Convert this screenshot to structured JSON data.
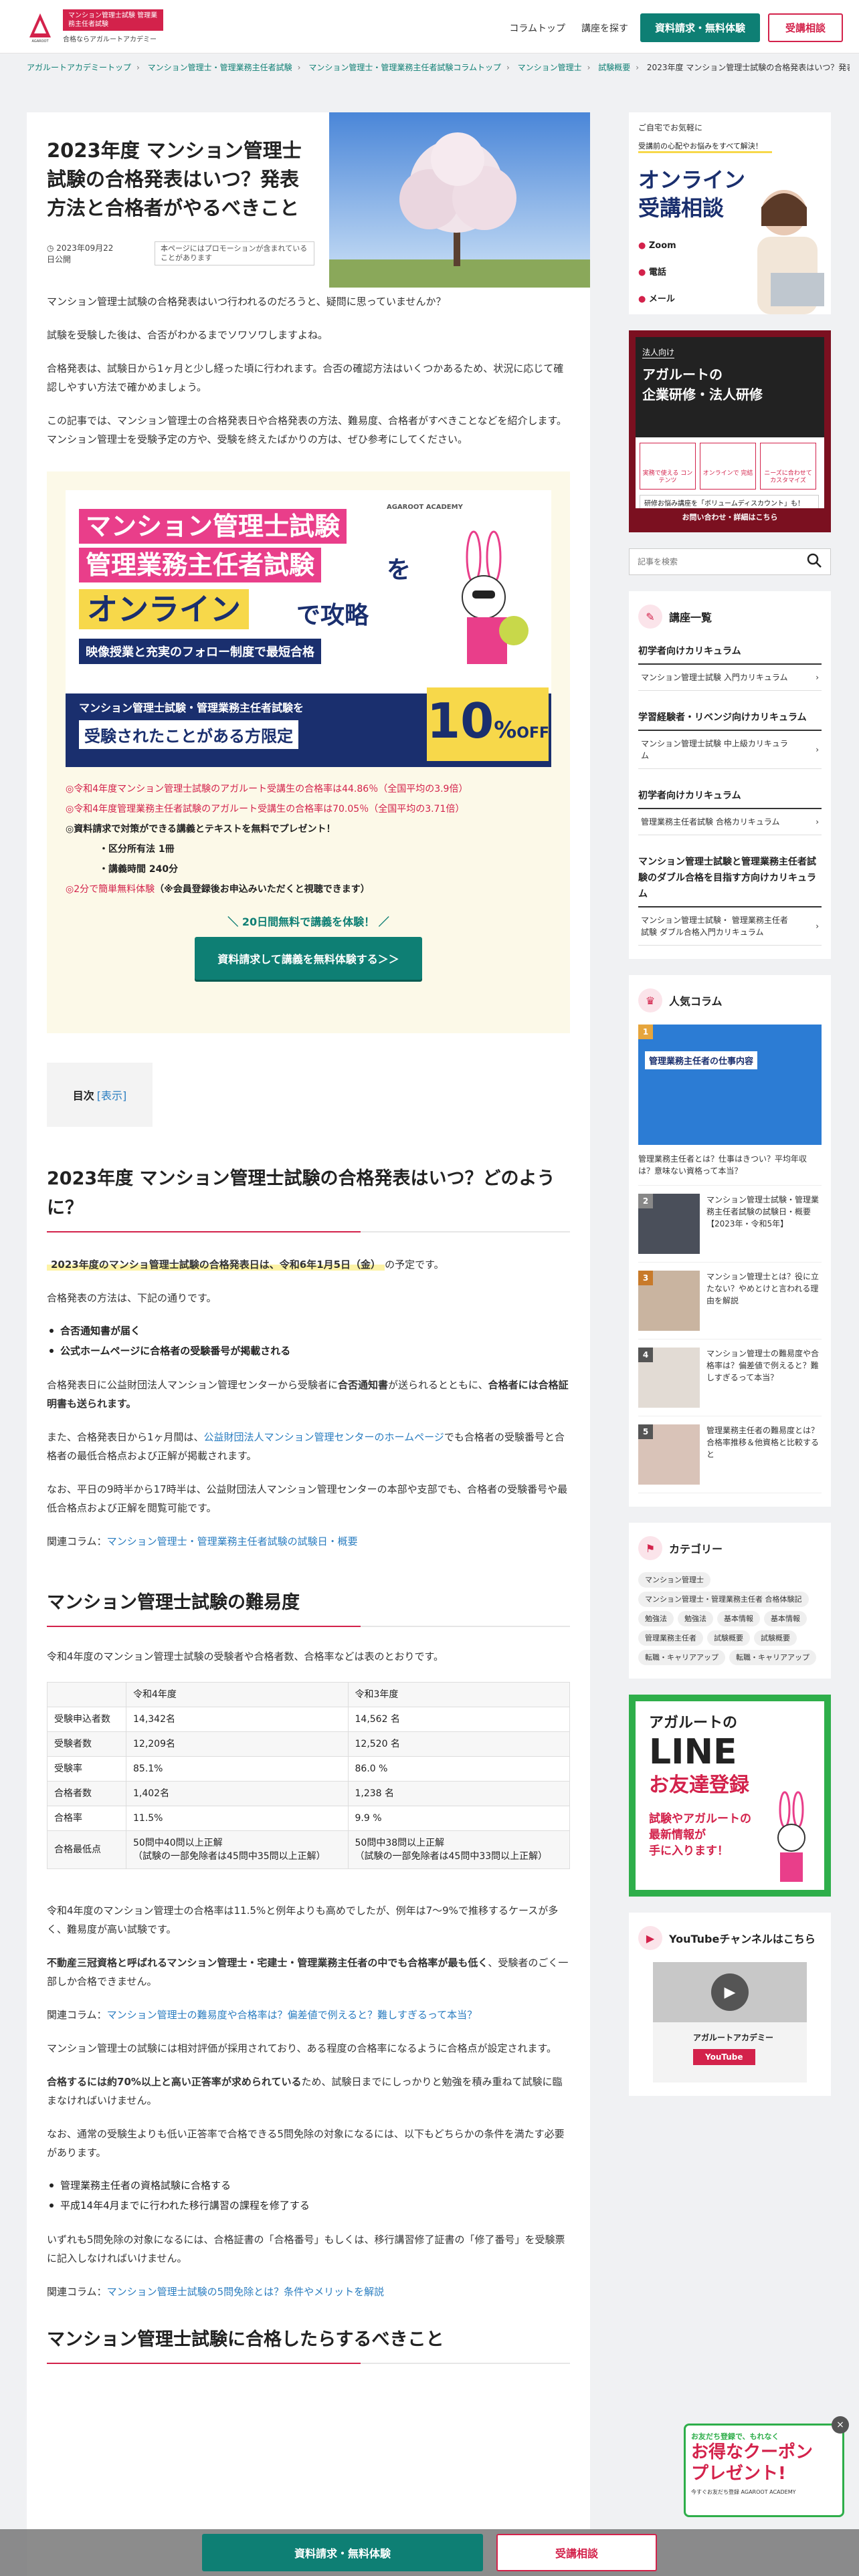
{
  "header": {
    "logo_tag": "マンション管理士試験 管理業務主任者試験",
    "logo_tag2": "合格ならアガルートアカデミー",
    "logo_brand": "AGAROOT ACADEMY",
    "nav": [
      "コラムトップ",
      "講座を探す"
    ],
    "cta_primary": "資料請求・無料体験",
    "cta_secondary": "受講相談"
  },
  "breadcrumb": [
    "アガルートアカデミートップ",
    "マンション管理士・管理業務主任者試験",
    "マンション管理士・管理業務主任者試験コラムトップ",
    "マンション管理士",
    "試験概要",
    "2023年度 マンション管理士試験の合格発表はいつ？発表方法と合格者がやるべきこと"
  ],
  "article": {
    "title": "2023年度 マンション管理士試験の合格発表はいつ？発表方法と合格者がやるべきこと",
    "date": "2023年09月22日公開",
    "promo_note": "本ページにはプロモーションが含まれていることがあります",
    "intro": [
      "マンション管理士試験の合格発表はいつ行われるのだろうと、疑問に思っていませんか？",
      "試験を受験した後は、合否がわかるまでソワソワしますよね。",
      "合格発表は、試験日から1ヶ月と少し経った頃に行われます。合否の確認方法はいくつかあるため、状況に応じて確認しやすい方法で確かめましょう。",
      "この記事では、マンション管理士の合格発表日や合格発表の方法、難易度、合格者がすべきことなどを紹介します。マンション管理士を受験予定の方や、受験を終えたばかりの方は、ぜひ参考にしてください。"
    ],
    "banner": {
      "line1": "マンション管理士試験",
      "line2": "管理業務主任者試験",
      "line2b": "を",
      "line3": "オンライン",
      "line3b": "で攻略",
      "line4": "映像授業と充実のフォロー制度で最短合格",
      "offer1": "マンション管理士試験・管理業務主任者試験を",
      "offer2": "受験されたことがある方限定",
      "discount": "10",
      "discount_unit": "%",
      "off": "OFF",
      "brand": "AGAROOT ACADEMY",
      "points": [
        "◎令和4年度マンション管理士試験のアガルート受講生の合格率は44.86％（全国平均の3.9倍）",
        "◎令和4年度管理業務主任者試験のアガルート受講生の合格率は70.05％（全国平均の3.71倍）"
      ],
      "gift_title": "◎資料請求で対策ができる講義とテキストを無料でプレゼント！",
      "gift_items": [
        "・区分所有法 1冊",
        "・講義時間 240分"
      ],
      "signup": "◎2分で簡単無料体験",
      "signup_note": "（※会員登録後お申込みいただくと視聴できます）",
      "cta_label": "＼ 20日間無料で講義を体験！ ／",
      "cta_button": "資料請求して講義を無料体験する＞＞"
    },
    "toc": {
      "label": "目次",
      "toggle": "[表示]"
    },
    "sec1": {
      "heading": "2023年度 マンション管理士試験の合格発表はいつ？どのように？",
      "lead": "2023年度のマンショ管理士試験の合格発表日は、令和6年1月5日（金）",
      "lead_tail": "の予定です。",
      "method_intro": "合格発表の方法は、下記の通りです。",
      "methods": [
        "合否通知書が届く",
        "公式ホームページに合格者の受験番号が掲載される"
      ],
      "p1a": "合格発表日に公益財団法人マンション管理センターから受験者に",
      "p1b": "合否通知書",
      "p1c": "が送られるとともに、",
      "p1d": "合格者には合格証明書も送られます。",
      "p2a": "また、合格発表日から1ヶ月間は、",
      "p2link": "公益財団法人マンション管理センターのホームページ",
      "p2b": "でも合格者の受験番号と合格者の最低合格点および正解が掲載されます。",
      "p3": "なお、平日の9時半から17時半は、公益財団法人マンション管理センターの本部や支部でも、合格者の受験番号や最低合格点および正解を閲覧可能です。",
      "related_label": "関連コラム：",
      "related_link": "マンション管理士・管理業務主任者試験の試験日・概要"
    },
    "sec2": {
      "heading": "マンション管理士試験の難易度",
      "intro": "令和4年度のマンション管理士試験の受験者や合格者数、合格率などは表のとおりです。",
      "table_head": [
        "",
        "令和4年度",
        "令和3年度"
      ],
      "table_rows": [
        [
          "受験申込者数",
          "14,342名",
          "14,562 名"
        ],
        [
          "受験者数",
          "12,209名",
          "12,520 名"
        ],
        [
          "受験率",
          "85.1%",
          "86.0 %"
        ],
        [
          "合格者数",
          "1,402名",
          "1,238 名"
        ],
        [
          "合格率",
          "11.5%",
          "9.9 %"
        ]
      ],
      "table_last_label": "合格最低点",
      "table_last_a1": "50問中40問以上正解",
      "table_last_a2": "（試験の一部免除者は45問中35問以上正解）",
      "table_last_b1": "50問中38問以上正解",
      "table_last_b2": "（試験の一部免除者は45問中33問以上正解）",
      "p1": "令和4年度のマンション管理士の合格率は11.5%と例年よりも高めでしたが、例年は7〜9%で推移するケースが多く、難易度が高い試験です。",
      "p2a": "不動産三冠資格と呼ばれるマンション管理士・宅建士・管理業務主任者の中でも合格率が最も低く",
      "p2b": "、受験者のごく一部しか合格できません。",
      "related1": "マンション管理士の難易度や合格率は？偏差値で例えると？難しすぎるって本当？",
      "p3": "マンション管理士の試験には相対評価が採用されており、ある程度の合格率になるように合格点が設定されます。",
      "p4a": "合格するには約70%以上と高い正答率が求められている",
      "p4b": "ため、試験日までにしっかりと勉強を積み重ねて試験に臨まなければいけません。",
      "p5": "なお、通常の受験生よりも低い正答率で合格できる5問免除の対象になるには、以下もどちらかの条件を満たす必要があります。",
      "conds": [
        "管理業務主任者の資格試験に合格する",
        "平成14年4月までに行われた移行講習の課程を修了する"
      ],
      "p6": "いずれも5問免除の対象になるには、合格証書の「合格番号」もしくは、移行講習修了証書の「修了番号」を受験票に記入しなければいけません。",
      "related2": "マンション管理士試験の5問免除とは？条件やメリットを解説",
      "next_heading": "マンション管理士試験に合格したらするべきこと"
    }
  },
  "sidebar": {
    "online": {
      "tag1": "ご自宅でお気軽に",
      "tag2": "受講前の心配やお悩みをすべて解決！",
      "title1": "オンライン",
      "title2": "受講相談",
      "methods": [
        "Zoom",
        "電話",
        "メール"
      ]
    },
    "corp": {
      "tag": "法人向け",
      "title1": "アガルートの",
      "title2": "企業研修・法人研修",
      "feat": [
        "実務で使える コンテンツ",
        "オンラインで 完結",
        "ニーズに合わせて カスタマイズ"
      ],
      "note": "研修お悩み講座を「ボリュームディスカウント」も！",
      "cta": "お問い合わせ・詳細はこちら"
    },
    "search_placeholder": "記事を検索",
    "courses": {
      "title": "講座一覧",
      "sections": [
        {
          "head": "初学者向けカリキュラム",
          "items": [
            "マンション管理士試験 入門カリキュラム"
          ]
        },
        {
          "head": "学習経験者・リベンジ向けカリキュラム",
          "items": [
            "マンション管理士試験 中上級カリキュラム"
          ]
        },
        {
          "head": "初学者向けカリキュラム",
          "items": [
            "管理業務主任者試験 合格カリキュラム"
          ]
        },
        {
          "head": "マンション管理士試験と管理業務主任者試験のダブル合格を目指す方向けカリキュラム",
          "items": [
            "マンション管理士試験・ 管理業務主任者試験 ダブル合格入門カリキュラム"
          ]
        }
      ]
    },
    "popular": {
      "title": "人気コラム",
      "first": "管理業務主任者とは？仕事はきつい？平均年収は？意味ない資格って本当？",
      "first_img_text": "管理業務主任者の仕事内容",
      "items": [
        {
          "num": "2",
          "title": "マンション管理士試験・管理業務主任者試験の試験日・概要【2023年・令和5年】"
        },
        {
          "num": "3",
          "title": "マンション管理士とは？役に立たない？やめとけと言われる理由を解説"
        },
        {
          "num": "4",
          "title": "マンション管理士の難易度や合格率は？偏差値で例えると？難しすぎるって本当？"
        },
        {
          "num": "5",
          "title": "管理業務主任者の難易度とは？合格率推移＆他資格と比較すると"
        }
      ]
    },
    "category": {
      "title": "カテゴリー",
      "tags": [
        "マンション管理士",
        "マンション管理士・管理業務主任者 合格体験記",
        "勉強法",
        "勉強法",
        "基本情報",
        "基本情報",
        "管理業務主任者",
        "試験概要",
        "試験概要",
        "転職・キャリアアップ",
        "転職・キャリアアップ"
      ]
    },
    "line": {
      "brand": "アガルートの",
      "big": "LINE",
      "sub": "お友達登録",
      "msg1": "試験やアガルートの",
      "msg2": "最新情報が",
      "msg3": "手に入ります！"
    },
    "youtube": {
      "title": "YouTubeチャンネルはこちら",
      "channel": "アガルートアカデミー",
      "button": "YouTube"
    }
  },
  "float": {
    "cta_primary": "資料請求・無料体験",
    "cta_secondary": "受講相談"
  },
  "coupon": {
    "line1": "お友だち登録で、もれなく",
    "line2": "お得なクーポン",
    "line3": "プレゼント!",
    "line4": "今すぐお友だち登録 AGAROOT ACADEMY"
  }
}
